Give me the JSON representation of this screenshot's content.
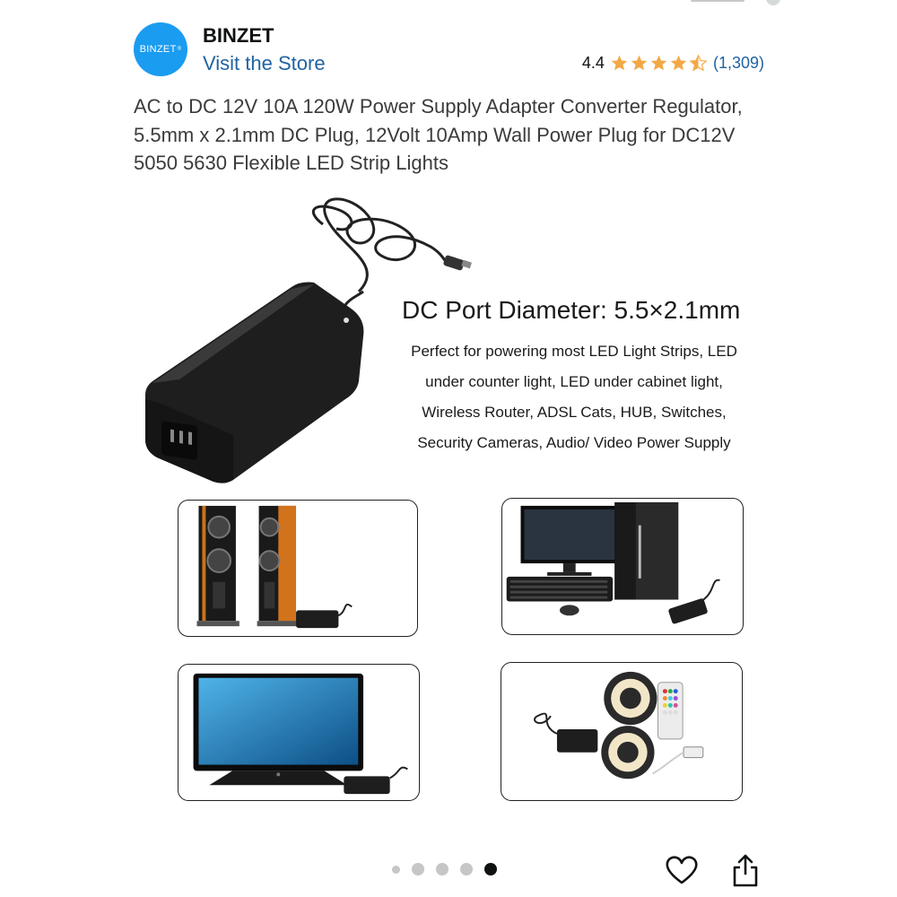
{
  "store": {
    "logo_text": "BINZET",
    "name": "BINZET",
    "visit_label": "Visit the Store"
  },
  "rating": {
    "value": "4.4",
    "stars": 4.4,
    "count": "(1,309)",
    "star_color": "#f3a847"
  },
  "product": {
    "title": "AC to DC 12V 10A 120W Power Supply Adapter Converter Regulator, 5.5mm x 2.1mm DC Plug, 12Volt 10Amp Wall Power Plug for DC12V 5050 5630 Flexible LED Strip Lights"
  },
  "image": {
    "port_title": "DC Port Diameter: 5.5×2.1mm",
    "description": "Perfect for powering most LED Light Strips, LED under counter light, LED under cabinet light, Wireless Router, ADSL Cats, HUB, Switches, Security Cameras, Audio/ Video Power Supply",
    "panels": [
      "speakers",
      "desktop-computer",
      "television",
      "led-strip-lights"
    ]
  },
  "carousel": {
    "total": 5,
    "active_index": 5
  },
  "colors": {
    "link": "#2162a1",
    "logo_bg": "#1a9cf0",
    "text": "#0f1111"
  },
  "icons": [
    "heart-icon",
    "share-icon",
    "star-icon"
  ]
}
